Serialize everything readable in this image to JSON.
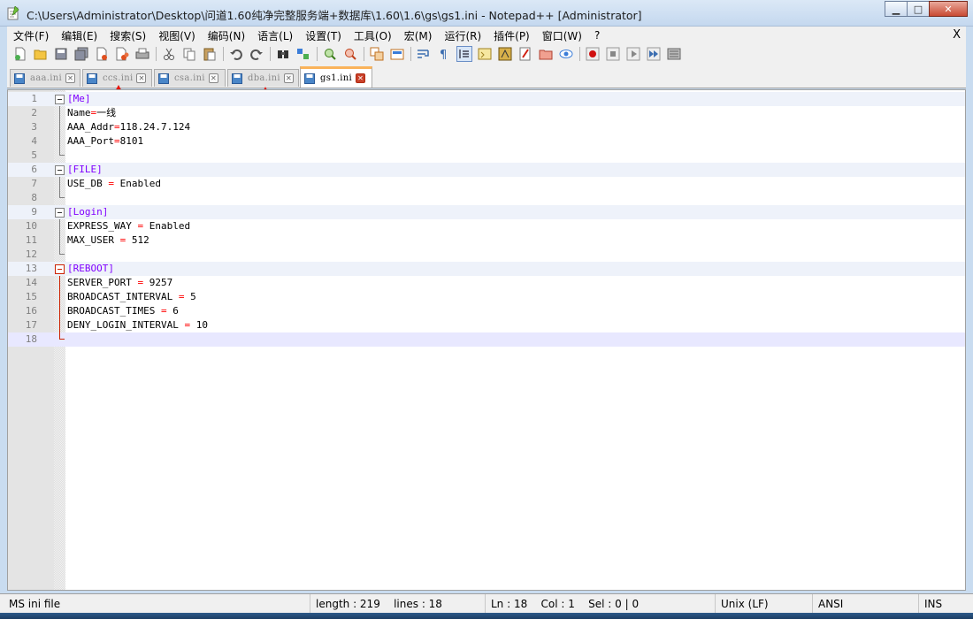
{
  "window": {
    "title": "C:\\Users\\Administrator\\Desktop\\问道1.60纯净完整服务端+数据库\\1.60\\1.6\\gs\\gs1.ini - Notepad++ [Administrator]",
    "minimize": "▁",
    "maximize": "□",
    "close": "✕"
  },
  "menu": {
    "items": [
      "文件(F)",
      "编辑(E)",
      "搜索(S)",
      "视图(V)",
      "编码(N)",
      "语言(L)",
      "设置(T)",
      "工具(O)",
      "宏(M)",
      "运行(R)",
      "插件(P)",
      "窗口(W)",
      "?"
    ],
    "close": "X"
  },
  "toolbar": {
    "icons": [
      "new-file-icon",
      "open-file-icon",
      "save-icon",
      "save-all-icon",
      "close-icon",
      "close-all-icon",
      "print-icon",
      "cut-icon",
      "copy-icon",
      "paste-icon",
      "undo-icon",
      "redo-icon",
      "find-icon",
      "replace-icon",
      "zoom-in-icon",
      "zoom-out-icon",
      "sync-vertical-icon",
      "sync-horizontal-icon",
      "word-wrap-icon",
      "show-all-chars-icon",
      "indent-guide-icon",
      "user-defined-language-icon",
      "document-map-icon",
      "function-list-icon",
      "folder-workspace-icon",
      "monitoring-icon",
      "record-macro-icon",
      "stop-macro-icon",
      "play-macro-icon",
      "run-macro-multiple-icon",
      "save-macro-icon"
    ]
  },
  "tabs": [
    {
      "label": "aaa.ini",
      "active": false
    },
    {
      "label": "ccs.ini",
      "active": false
    },
    {
      "label": "csa.ini",
      "active": false
    },
    {
      "label": "dba.ini",
      "active": false
    },
    {
      "label": "gs1.ini",
      "active": true
    }
  ],
  "editor": {
    "lines": [
      {
        "n": "1",
        "section": "[Me]"
      },
      {
        "n": "2",
        "key": "Name",
        "eq": "=",
        "val": "一线",
        "compact": true
      },
      {
        "n": "3",
        "key": "AAA_Addr",
        "eq": "=",
        "val": "118.24.7.124",
        "compact": true
      },
      {
        "n": "4",
        "key": "AAA_Port",
        "eq": "=",
        "val": "8101",
        "compact": true
      },
      {
        "n": "5",
        "blank": true
      },
      {
        "n": "6",
        "section": "[FILE]"
      },
      {
        "n": "7",
        "key": "USE_DB",
        "eq": "=",
        "val": "Enabled"
      },
      {
        "n": "8",
        "blank": true
      },
      {
        "n": "9",
        "section": "[Login]"
      },
      {
        "n": "10",
        "key": "EXPRESS_WAY",
        "eq": "=",
        "val": "Enabled"
      },
      {
        "n": "11",
        "key": "MAX_USER",
        "eq": "=",
        "val": "512"
      },
      {
        "n": "12",
        "blank": true
      },
      {
        "n": "13",
        "section": "[REBOOT]",
        "red": true
      },
      {
        "n": "14",
        "key": "SERVER_PORT",
        "eq": "=",
        "val": "9257"
      },
      {
        "n": "15",
        "key": "BROADCAST_INTERVAL",
        "eq": "=",
        "val": "5"
      },
      {
        "n": "16",
        "key": "BROADCAST_TIMES",
        "eq": "=",
        "val": "6"
      },
      {
        "n": "17",
        "key": "DENY_LOGIN_INTERVAL",
        "eq": "=",
        "val": "10"
      },
      {
        "n": "18",
        "blank": true,
        "current": true
      }
    ]
  },
  "status": {
    "file_type": "MS ini file",
    "length": "length : 219",
    "lines": "lines : 18",
    "ln": "Ln : 18",
    "col": "Col : 1",
    "sel": "Sel : 0 | 0",
    "eol": "Unix (LF)",
    "encoding": "ANSI",
    "mode": "INS"
  },
  "colors": {
    "section": "#8000ff",
    "operator": "#ff0000",
    "fold_active": "#cc2200",
    "arrow": "#e8140a",
    "active_tab_accent": "#fab35b"
  }
}
